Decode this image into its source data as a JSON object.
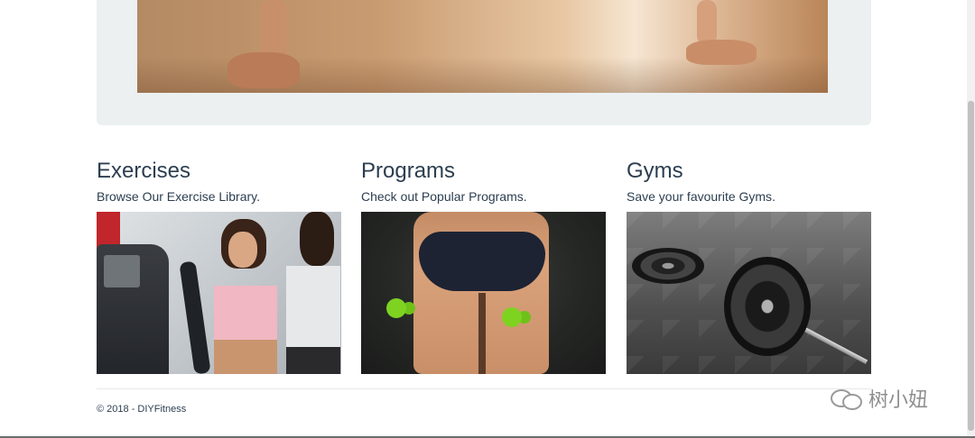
{
  "sections": [
    {
      "title": "Exercises",
      "subtitle": "Browse Our Exercise Library."
    },
    {
      "title": "Programs",
      "subtitle": "Check out Popular Programs."
    },
    {
      "title": "Gyms",
      "subtitle": "Save your favourite Gyms."
    }
  ],
  "footer": {
    "copyright": "© 2018 - DIYFitness"
  },
  "watermark": {
    "text": "树小妞",
    "icon": "wechat-icon"
  },
  "colors": {
    "text": "#2c3e50",
    "jumbotron": "#ecf0f1",
    "dumbbell": "#7ed321"
  }
}
